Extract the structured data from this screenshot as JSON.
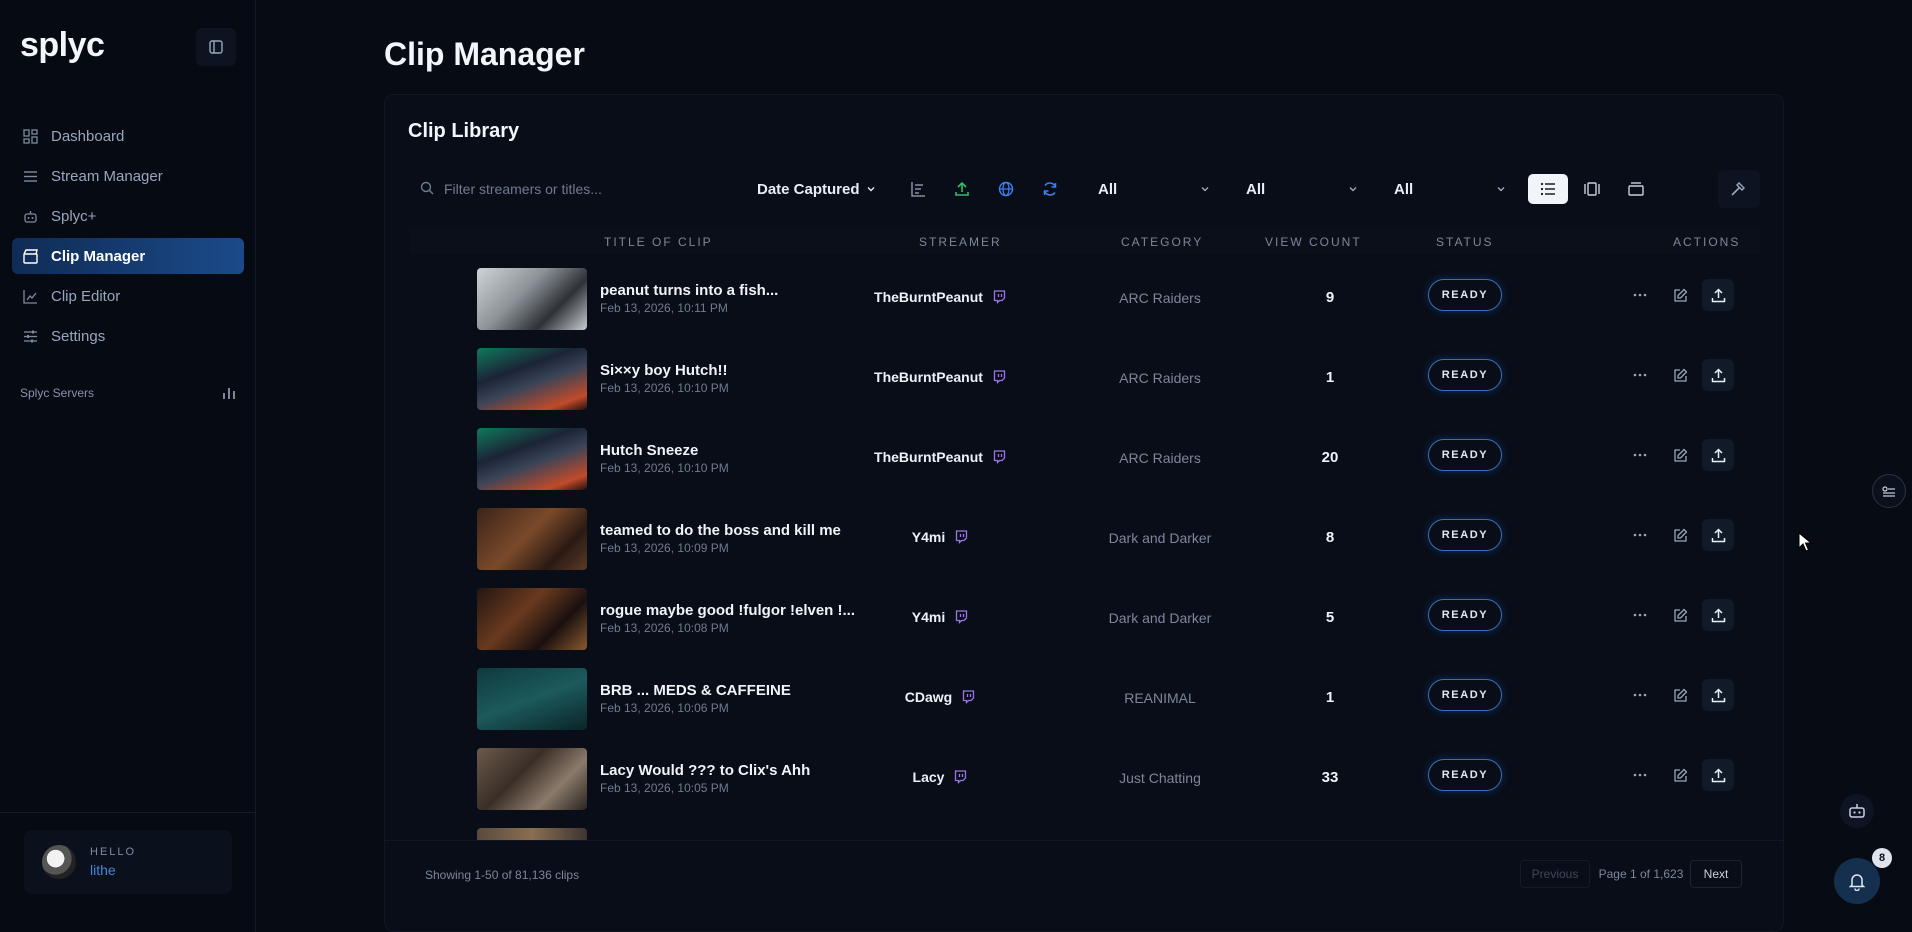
{
  "app": {
    "logo": "splyc"
  },
  "sidebar": {
    "items": [
      {
        "label": "Dashboard",
        "icon": "grid-icon"
      },
      {
        "label": "Stream Manager",
        "icon": "list-icon"
      },
      {
        "label": "Splyc+",
        "icon": "robot-icon"
      },
      {
        "label": "Clip Manager",
        "icon": "clapper-icon",
        "active": true
      },
      {
        "label": "Clip Editor",
        "icon": "chart-edit-icon"
      },
      {
        "label": "Settings",
        "icon": "sliders-icon"
      }
    ],
    "servers_label": "Splyc Servers",
    "user": {
      "hello": "HELLO",
      "name": "lithe"
    }
  },
  "page": {
    "title": "Clip Manager"
  },
  "library": {
    "title": "Clip Library",
    "search_placeholder": "Filter streamers or titles...",
    "sort_label": "Date Captured",
    "filters": [
      "All",
      "All",
      "All"
    ],
    "columns": {
      "title": "TITLE OF CLIP",
      "streamer": "STREAMER",
      "category": "CATEGORY",
      "views": "VIEW COUNT",
      "status": "STATUS",
      "actions": "ACTIONS"
    },
    "rows": [
      {
        "title": "peanut turns into a fish...",
        "date": "Feb 13, 2026, 10:11 PM",
        "streamer": "TheBurntPeanut",
        "category": "ARC Raiders",
        "views": "9",
        "status": "READY"
      },
      {
        "title": "Si××y boy Hutch!!",
        "date": "Feb 13, 2026, 10:10 PM",
        "streamer": "TheBurntPeanut",
        "category": "ARC Raiders",
        "views": "1",
        "status": "READY"
      },
      {
        "title": "Hutch Sneeze",
        "date": "Feb 13, 2026, 10:10 PM",
        "streamer": "TheBurntPeanut",
        "category": "ARC Raiders",
        "views": "20",
        "status": "READY"
      },
      {
        "title": "teamed to do the boss and kill me",
        "date": "Feb 13, 2026, 10:09 PM",
        "streamer": "Y4mi",
        "category": "Dark and Darker",
        "views": "8",
        "status": "READY"
      },
      {
        "title": "rogue maybe good !fulgor !elven !...",
        "date": "Feb 13, 2026, 10:08 PM",
        "streamer": "Y4mi",
        "category": "Dark and Darker",
        "views": "5",
        "status": "READY"
      },
      {
        "title": "BRB ... MEDS & CAFFEINE",
        "date": "Feb 13, 2026, 10:06 PM",
        "streamer": "CDawg",
        "category": "REANIMAL",
        "views": "1",
        "status": "READY"
      },
      {
        "title": "Lacy Would ??? to Clix's Ahh",
        "date": "Feb 13, 2026, 10:05 PM",
        "streamer": "Lacy",
        "category": "Just Chatting",
        "views": "33",
        "status": "READY"
      }
    ],
    "footer": {
      "showing": "Showing 1-50 of 81,136 clips",
      "previous": "Previous",
      "page": "Page 1 of 1,623",
      "next": "Next"
    }
  },
  "notifications": {
    "count": "8"
  },
  "colors": {
    "accent": "#1b4a8a",
    "twitch": "#9a74e8",
    "ready_border": "#3a6fb8"
  }
}
